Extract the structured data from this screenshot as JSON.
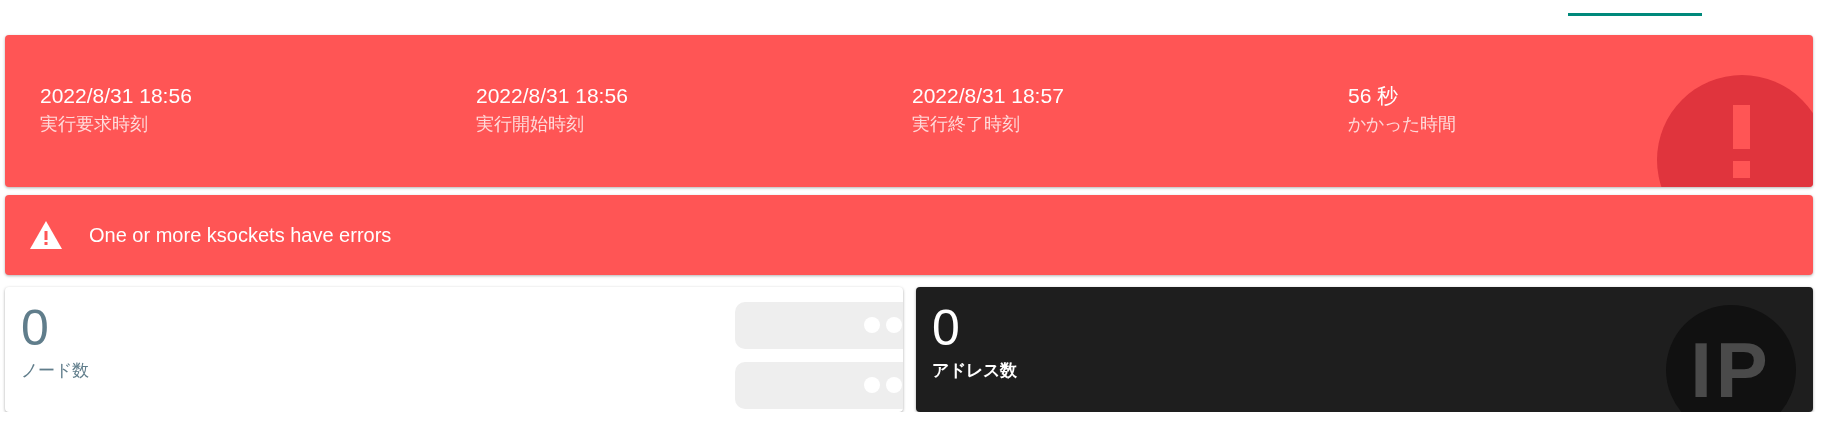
{
  "summary": {
    "items": [
      {
        "value": "2022/8/31 18:56",
        "label": "実行要求時刻"
      },
      {
        "value": "2022/8/31 18:56",
        "label": "実行開始時刻"
      },
      {
        "value": "2022/8/31 18:57",
        "label": "実行終了時刻"
      },
      {
        "value": "56 秒",
        "label": "かかった時間"
      }
    ]
  },
  "alert": {
    "message": "One or more ksockets have errors"
  },
  "stats": [
    {
      "kind": "nodes",
      "value": "0",
      "label": "ノード数"
    },
    {
      "kind": "addresses",
      "value": "0",
      "label": "アドレス数",
      "icon_text": "IP"
    }
  ]
}
